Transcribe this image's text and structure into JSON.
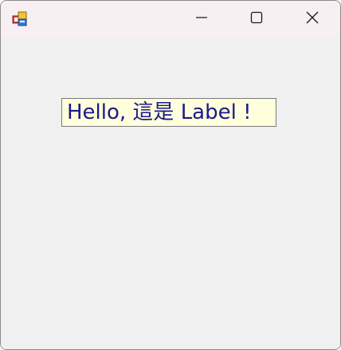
{
  "window": {
    "title": "",
    "icon": "winforms-app-icon",
    "caption_buttons": {
      "minimize_icon": "minimize-icon",
      "maximize_icon": "maximize-icon",
      "close_icon": "close-icon"
    }
  },
  "label": {
    "text": "Hello, 這是 Label !",
    "background": "#ffffdc",
    "foreground": "#1a1a8c"
  }
}
